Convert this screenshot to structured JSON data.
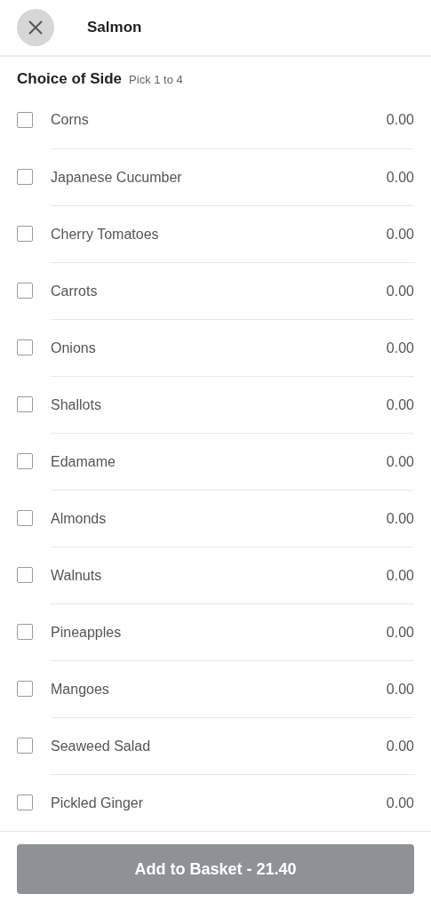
{
  "header": {
    "title": "Salmon"
  },
  "section": {
    "title": "Choice of Side",
    "hint": "Pick 1 to 4",
    "options": [
      {
        "label": "Corns",
        "price": "0.00",
        "checked": false
      },
      {
        "label": "Japanese Cucumber",
        "price": "0.00",
        "checked": false
      },
      {
        "label": "Cherry Tomatoes",
        "price": "0.00",
        "checked": false
      },
      {
        "label": "Carrots",
        "price": "0.00",
        "checked": false
      },
      {
        "label": "Onions",
        "price": "0.00",
        "checked": false
      },
      {
        "label": "Shallots",
        "price": "0.00",
        "checked": false
      },
      {
        "label": "Edamame",
        "price": "0.00",
        "checked": false
      },
      {
        "label": "Almonds",
        "price": "0.00",
        "checked": false
      },
      {
        "label": "Walnuts",
        "price": "0.00",
        "checked": false
      },
      {
        "label": "Pineapples",
        "price": "0.00",
        "checked": false
      },
      {
        "label": "Mangoes",
        "price": "0.00",
        "checked": false
      },
      {
        "label": "Seaweed Salad",
        "price": "0.00",
        "checked": false
      },
      {
        "label": "Pickled Ginger",
        "price": "0.00",
        "checked": false
      }
    ]
  },
  "footer": {
    "button": "Add to Basket - 21.40",
    "disabled": true
  }
}
